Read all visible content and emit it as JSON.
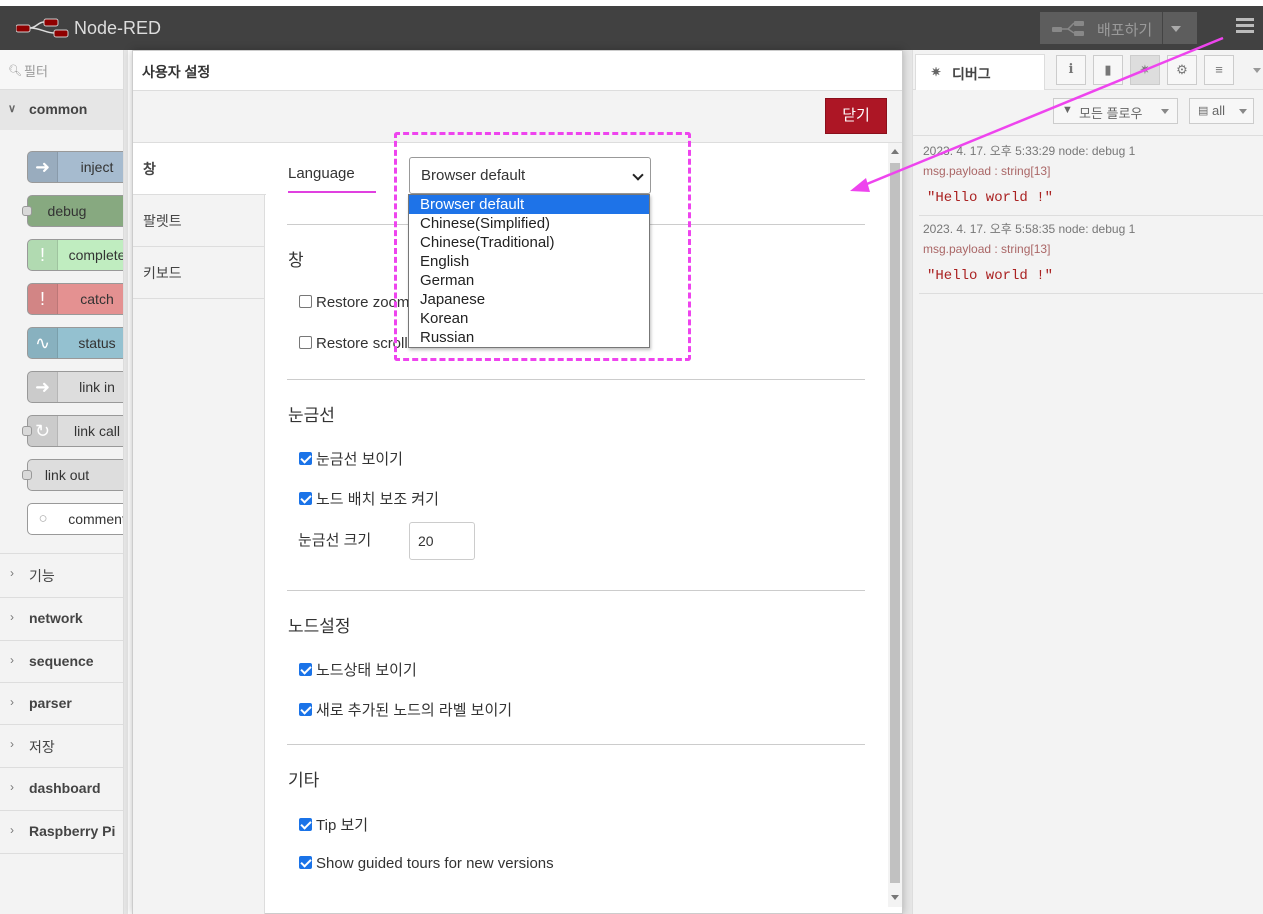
{
  "header": {
    "brand": "Node-RED",
    "deploy_label": "배포하기"
  },
  "palette": {
    "filter_placeholder": "필터",
    "common_label": "common",
    "nodes": [
      {
        "label": "inject",
        "color": "#a6bbcf",
        "icon": "inject-icon"
      },
      {
        "label": "debug",
        "color": "#87a980",
        "icon": "debug-icon"
      },
      {
        "label": "complete",
        "color": "#c0edc0",
        "icon": "complete-icon"
      },
      {
        "label": "catch",
        "color": "#e49191",
        "icon": "catch-icon"
      },
      {
        "label": "status",
        "color": "#94c1d0",
        "icon": "status-icon"
      },
      {
        "label": "link in",
        "color": "#dddddd",
        "icon": "link-in-icon"
      },
      {
        "label": "link call",
        "color": "#dddddd",
        "icon": "link-call-icon"
      },
      {
        "label": "link out",
        "color": "#dddddd",
        "icon": "link-out-icon"
      },
      {
        "label": "comment",
        "color": "#ffffff",
        "icon": "comment-icon"
      }
    ],
    "categories": [
      "기능",
      "network",
      "sequence",
      "parser",
      "저장",
      "dashboard",
      "Raspberry Pi"
    ]
  },
  "dialog": {
    "title": "사용자 설정",
    "close_label": "닫기",
    "tabs": [
      "창",
      "팔렛트",
      "키보드"
    ],
    "language_label": "Language",
    "language_value": "Browser default",
    "language_options": [
      "Browser default",
      "Chinese(Simplified)",
      "Chinese(Traditional)",
      "English",
      "German",
      "Japanese",
      "Korean",
      "Russian"
    ],
    "section_view": "창",
    "restore_zoom": "Restore zoom",
    "restore_scroll": "Restore scroll",
    "section_grid": "눈금선",
    "show_grid": "눈금선 보이기",
    "snap_grid": "노드 배치 보조 켜기",
    "grid_size_label": "눈금선 크기",
    "grid_size_value": "20",
    "section_nodes": "노드설정",
    "show_status": "노드상태 보이기",
    "show_labels": "새로 추가된 노드의 라벨 보이기",
    "section_other": "기타",
    "show_tips": "Tip 보기",
    "show_tours": "Show guided tours for new versions"
  },
  "sidebar": {
    "tab_label": "디버그",
    "filter_label": "모든 플로우",
    "all_label": "all",
    "messages": [
      {
        "meta": "2023. 4. 17. 오후 5:33:29   node: debug 1",
        "type": "msg.payload : string[13]",
        "value": "\"Hello world !\""
      },
      {
        "meta": "2023. 4. 17. 오후 5:58:35   node: debug 1",
        "type": "msg.payload : string[13]",
        "value": "\"Hello world !\""
      }
    ]
  },
  "colors": {
    "header_bg": "#414141",
    "close_button": "#ad1625",
    "annotation": "#ee44ee",
    "selected_option": "#1e73e8"
  }
}
